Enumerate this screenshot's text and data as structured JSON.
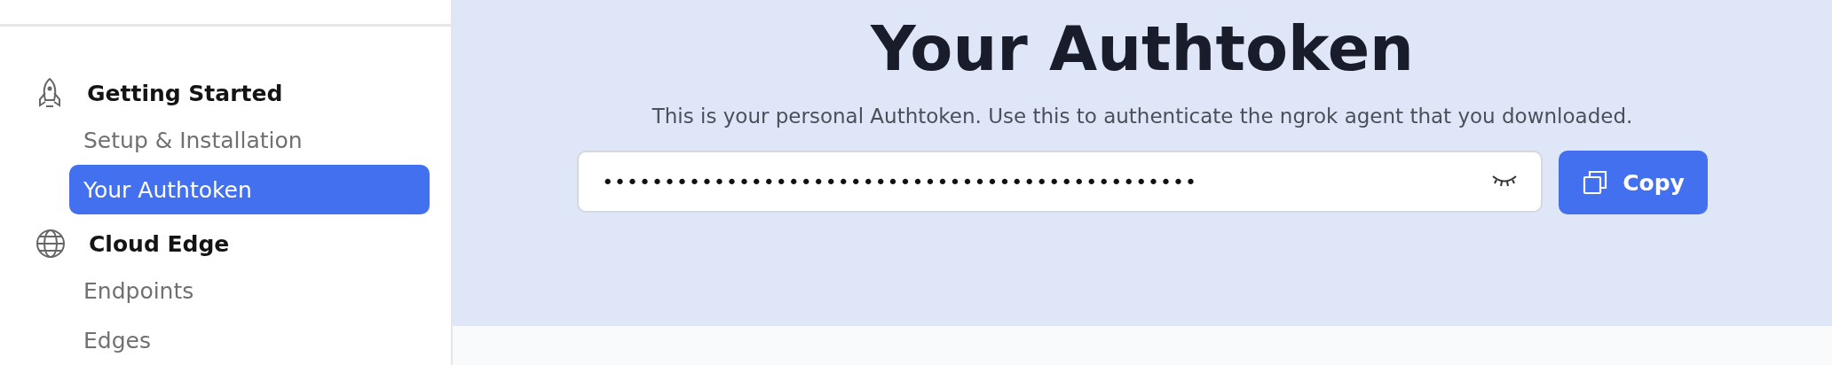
{
  "sidebar": {
    "sections": [
      {
        "kind": "rocket",
        "title": "Getting Started",
        "items": [
          {
            "label": "Setup & Installation",
            "selected": false
          },
          {
            "label": "Your Authtoken",
            "selected": true
          }
        ]
      },
      {
        "kind": "globe",
        "title": "Cloud Edge",
        "items": [
          {
            "label": "Endpoints",
            "selected": false
          },
          {
            "label": "Edges",
            "selected": false
          }
        ]
      }
    ]
  },
  "main": {
    "title": "Your Authtoken",
    "description": "This is your personal Authtoken. Use this to authenticate the ngrok agent that you downloaded.",
    "token_field": {
      "value": "••••••••••••••••••••••••••••••••••••••••••••••••",
      "revealed": false
    },
    "copy_button": "Copy"
  }
}
